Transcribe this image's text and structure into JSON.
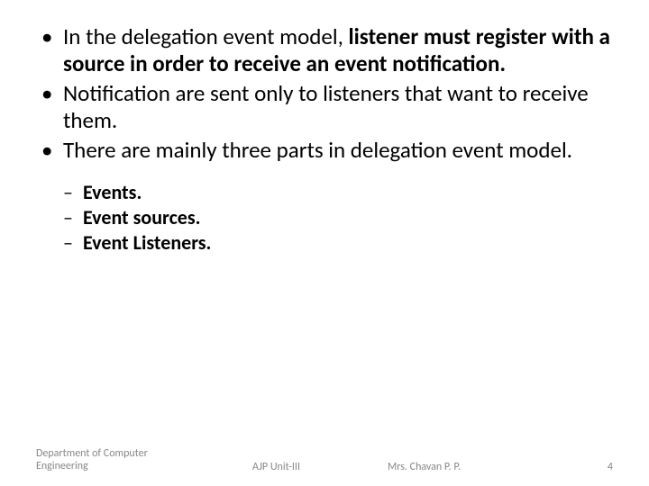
{
  "bullets": {
    "b1_plain": "In the delegation event model, ",
    "b1_bold": "listener must register with a source in order to receive an event notification.",
    "b2": "Notification are sent only to listeners that want to receive them.",
    "b3": "There are mainly three parts in delegation event model."
  },
  "subbullets": {
    "s1": "Events.",
    "s2": "Event sources.",
    "s3": "Event Listeners."
  },
  "footer": {
    "department": "Department of Computer Engineering",
    "unit": "AJP Unit-III",
    "author": "Mrs. Chavan P. P.",
    "page": "4"
  }
}
